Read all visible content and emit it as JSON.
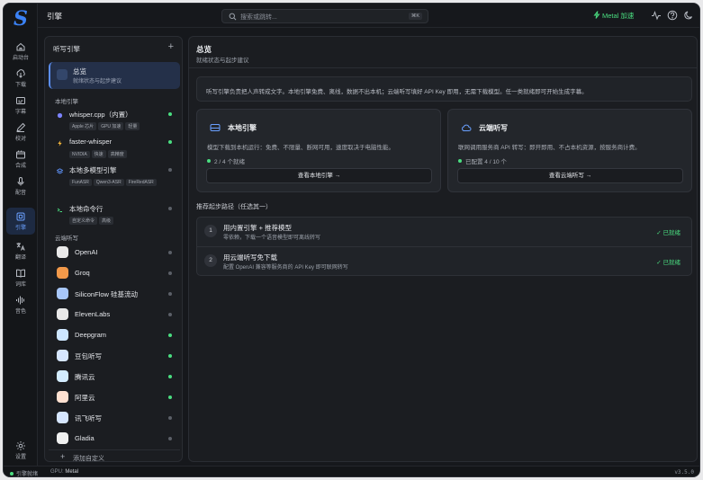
{
  "app": {
    "logo": "S",
    "page_title": "引擎",
    "search_placeholder": "搜索或跳转...",
    "search_shortcut": "⌘K",
    "accel_badge": "Metal 加速",
    "accent": "#3b82f6"
  },
  "rail": {
    "items": [
      {
        "label": "启动台",
        "icon": "home-icon"
      },
      {
        "label": "下载",
        "icon": "download-icon"
      },
      {
        "label": "字幕",
        "icon": "subtitle-icon"
      },
      {
        "label": "校对",
        "icon": "pen-icon"
      },
      {
        "label": "合成",
        "icon": "compose-icon"
      },
      {
        "label": "配音",
        "icon": "mic-icon"
      },
      {
        "label": "引擎",
        "icon": "engine-icon",
        "active": true
      },
      {
        "label": "翻译",
        "icon": "translate-icon"
      },
      {
        "label": "词库",
        "icon": "book-icon"
      },
      {
        "label": "音色",
        "icon": "waveform-icon"
      }
    ],
    "settings_label": "设置"
  },
  "engine_list": {
    "header": "听写引擎",
    "add": "+",
    "overview": {
      "title": "总览",
      "subtitle": "就绪状态与起步建议"
    },
    "local_label": "本地引擎",
    "local": [
      {
        "name": "whisper.cpp（内置）",
        "tags": [
          "Apple 芯片",
          "GPU 加速",
          "轻量"
        ],
        "ready": true,
        "color": "#7c83ff"
      },
      {
        "name": "faster-whisper",
        "tags": [
          "NVIDIA",
          "快速",
          "高精度"
        ],
        "ready": true,
        "color": "#f5b73b"
      },
      {
        "name": "本地多模型引擎",
        "tags": [
          "FunASR",
          "Qwen3-ASR",
          "FireRedASR"
        ],
        "ready": false,
        "color": "#5b8def"
      },
      {
        "name": "本地命令行",
        "tags": [
          "自定义命令",
          "高级"
        ],
        "ready": false,
        "color": "#4ade80"
      }
    ],
    "cloud_label": "云端听写",
    "cloud": [
      {
        "name": "OpenAI",
        "ready": false,
        "color": "#e9e9e9"
      },
      {
        "name": "Groq",
        "ready": false,
        "color": "#f2994a"
      },
      {
        "name": "SiliconFlow 硅基流动",
        "ready": false,
        "color": "#a8c7fa"
      },
      {
        "name": "ElevenLabs",
        "ready": false,
        "color": "#e9e9e9"
      },
      {
        "name": "Deepgram",
        "ready": true,
        "color": "#cde6ff"
      },
      {
        "name": "豆包听写",
        "ready": true,
        "color": "#d6e6ff"
      },
      {
        "name": "腾讯云",
        "ready": true,
        "color": "#d3ecff"
      },
      {
        "name": "阿里云",
        "ready": true,
        "color": "#ffe1d1"
      },
      {
        "name": "讯飞听写",
        "ready": false,
        "color": "#d6e6ff"
      },
      {
        "name": "Gladia",
        "ready": false,
        "color": "#f0f0f0"
      }
    ],
    "add_custom": "添加自定义"
  },
  "main": {
    "title": "总览",
    "subtitle": "就绪状态与起步建议",
    "info": "听写引擎负责把人声转成文字。本地引擎免费、离线，数据不出本机；云端听写填好 API Key 即用，无需下载模型。任一类就绪即可开始生成字幕。",
    "local_card": {
      "title": "本地引擎",
      "desc": "模型下载到本机运行：免费、不限量、断网可用，速度取决于电脑性能。",
      "status": "2 / 4 个就绪",
      "button": "查看本地引擎 →"
    },
    "cloud_card": {
      "title": "云端听写",
      "desc": "联网调用服务商 API 转写：即开即用、不占本机资源，按服务商计费。",
      "status": "已配置 4 / 10 个",
      "button": "查看云端听写 →"
    },
    "path_label": "推荐起步路径（任选其一）",
    "steps": [
      {
        "num": "1",
        "title": "用内置引擎 + 推荐模型",
        "desc": "零依赖，下载一个语音模型即可离线转写",
        "status": "✓ 已就绪"
      },
      {
        "num": "2",
        "title": "用云端听写免下载",
        "desc": "配置 OpenAI 兼容等服务商的 API Key 即可联网转写",
        "status": "✓ 已就绪"
      }
    ]
  },
  "status_bar": {
    "engine": "引擎就绪",
    "gpu_label": "GPU:",
    "gpu_value": "Metal",
    "version": "v3.5.0"
  }
}
